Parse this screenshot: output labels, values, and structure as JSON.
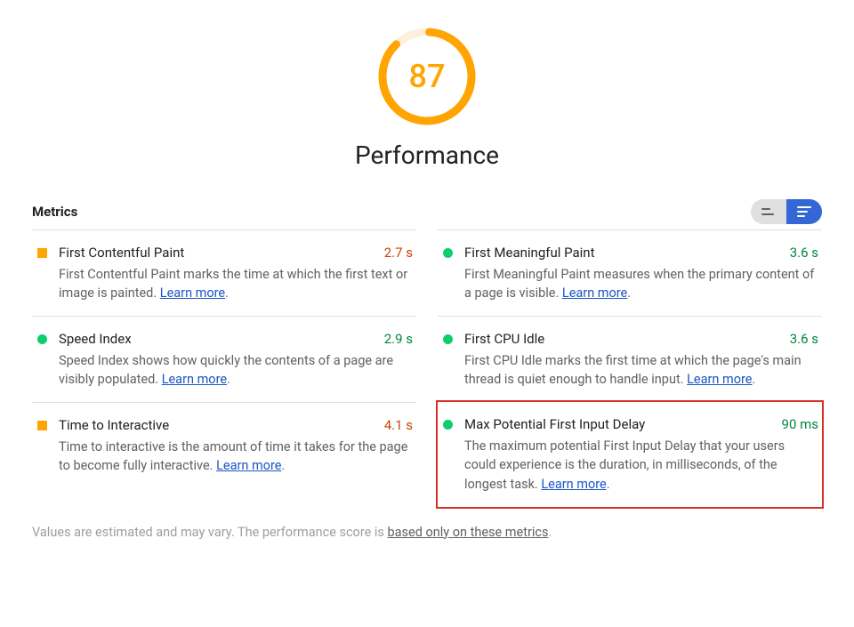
{
  "score": {
    "value": "87",
    "label": "Performance",
    "percent": 87
  },
  "header": {
    "title": "Metrics"
  },
  "metrics": [
    {
      "status": "orange",
      "name": "First Contentful Paint",
      "value": "2.7 s",
      "desc": "First Contentful Paint marks the time at which the first text or image is painted. ",
      "learn": "Learn more"
    },
    {
      "status": "green",
      "name": "First Meaningful Paint",
      "value": "3.6 s",
      "desc": "First Meaningful Paint measures when the primary content of a page is visible. ",
      "learn": "Learn more"
    },
    {
      "status": "green",
      "name": "Speed Index",
      "value": "2.9 s",
      "desc": "Speed Index shows how quickly the contents of a page are visibly populated. ",
      "learn": "Learn more"
    },
    {
      "status": "green",
      "name": "First CPU Idle",
      "value": "3.6 s",
      "desc": "First CPU Idle marks the first time at which the page's main thread is quiet enough to handle input. ",
      "learn": "Learn more"
    },
    {
      "status": "orange",
      "name": "Time to Interactive",
      "value": "4.1 s",
      "desc": "Time to interactive is the amount of time it takes for the page to become fully interactive. ",
      "learn": "Learn more"
    },
    {
      "status": "green",
      "name": "Max Potential First Input Delay",
      "value": "90 ms",
      "desc": "The maximum potential First Input Delay that your users could experience is the duration, in milliseconds, of the longest task. ",
      "learn": "Learn more",
      "highlight": true
    }
  ],
  "footnote": {
    "prefix": "Values are estimated and may vary. The performance score is ",
    "link": "based only on these metrics",
    "suffix": "."
  }
}
